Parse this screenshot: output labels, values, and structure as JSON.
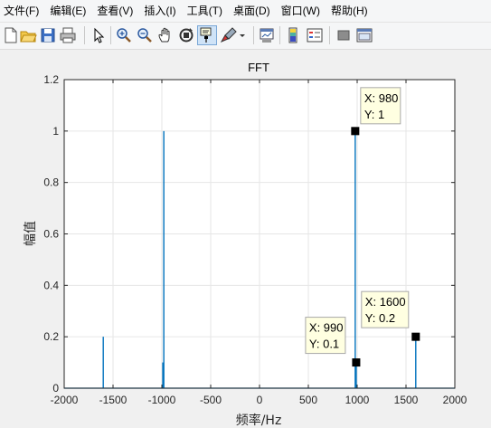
{
  "menu": [
    "文件(F)",
    "编辑(E)",
    "查看(V)",
    "插入(I)",
    "工具(T)",
    "桌面(D)",
    "窗口(W)",
    "帮助(H)"
  ],
  "toolbar": {
    "icons": [
      "new-figure-icon",
      "open-file-icon",
      "save-icon",
      "print-icon",
      "pointer-icon",
      "zoom-in-icon",
      "zoom-out-icon",
      "pan-icon",
      "rotate-3d-icon",
      "data-cursor-icon",
      "brush-icon",
      "brush-dropdown-icon",
      "link-plot-icon",
      "colorbar-icon",
      "legend-icon",
      "hide-plot-tools-icon",
      "show-plot-tools-icon"
    ]
  },
  "chart_data": {
    "type": "line",
    "title": "FFT",
    "xlabel": "频率/Hz",
    "ylabel": "幅值",
    "xlim": [
      -2000,
      2000
    ],
    "ylim": [
      0,
      1.2
    ],
    "xticks": [
      -2000,
      -1500,
      -1000,
      -500,
      0,
      500,
      1000,
      1500,
      2000
    ],
    "yticks": [
      0,
      0.2,
      0.4,
      0.6,
      0.8,
      1,
      1.2
    ],
    "xtick_labels": [
      "-2000",
      "-1500",
      "-1000",
      "-500",
      "0",
      "500",
      "1000",
      "1500",
      "2000"
    ],
    "ytick_labels": [
      "0",
      "0.2",
      "0.4",
      "0.6",
      "0.8",
      "1",
      "1.2"
    ],
    "grid": true,
    "series_color": "#0072bd",
    "peaks": [
      {
        "x": -1600,
        "y": 0.2
      },
      {
        "x": -990,
        "y": 0.1
      },
      {
        "x": -980,
        "y": 1
      },
      {
        "x": 980,
        "y": 1
      },
      {
        "x": 990,
        "y": 0.1
      },
      {
        "x": 1600,
        "y": 0.2
      }
    ],
    "datatips": [
      {
        "x": 980,
        "y": 1,
        "x_label": "X: 980",
        "y_label": "Y: 1"
      },
      {
        "x": 990,
        "y": 0.1,
        "x_label": "X: 990",
        "y_label": "Y: 0.1"
      },
      {
        "x": 1600,
        "y": 0.2,
        "x_label": "X: 1600",
        "y_label": "Y: 0.2"
      }
    ]
  }
}
